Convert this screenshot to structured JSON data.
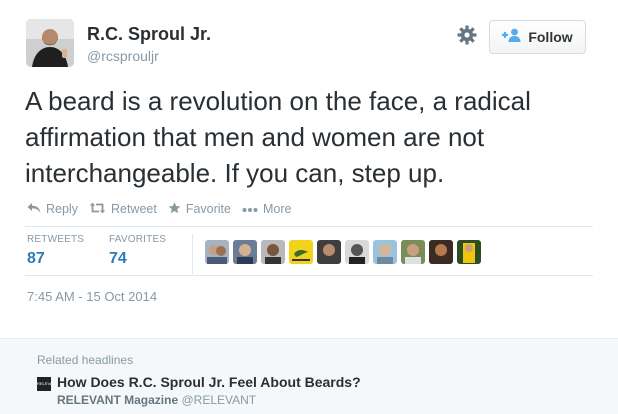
{
  "colors": {
    "accent": "#55acee",
    "muted": "#8899a6",
    "text": "#292f33",
    "favorites": "#2b7bb9"
  },
  "author": {
    "name": "R.C. Sproul Jr.",
    "handle": "@rcsprouljr"
  },
  "header": {
    "settings_icon": "gear-icon",
    "follow_label": "Follow",
    "follow_icon": "person-add-icon"
  },
  "tweet": {
    "text": "A beard is a revolution on the face, a radical\naffirmation that men and women are not\ninterchangeable. If you can, step up."
  },
  "actions": [
    {
      "label": "Reply",
      "icon": "reply-icon"
    },
    {
      "label": "Retweet",
      "icon": "retweet-icon"
    },
    {
      "label": "Favorite",
      "icon": "star-icon"
    },
    {
      "label": "More",
      "icon": "more-dots-icon"
    }
  ],
  "stats": {
    "retweets_label": "RETWEETS",
    "retweets_count": "87",
    "favorites_label": "FAVORITES",
    "favorites_count": "74"
  },
  "favoriters_shown": 10,
  "timestamp": "7:45 AM - 15 Oct 2014",
  "related": {
    "title": "Related headlines",
    "logo_text": "RELEVANT",
    "headline": "How Does R.C. Sproul Jr. Feel About Beards?",
    "source": "RELEVANT Magazine",
    "source_handle": "@RELEVANT"
  }
}
